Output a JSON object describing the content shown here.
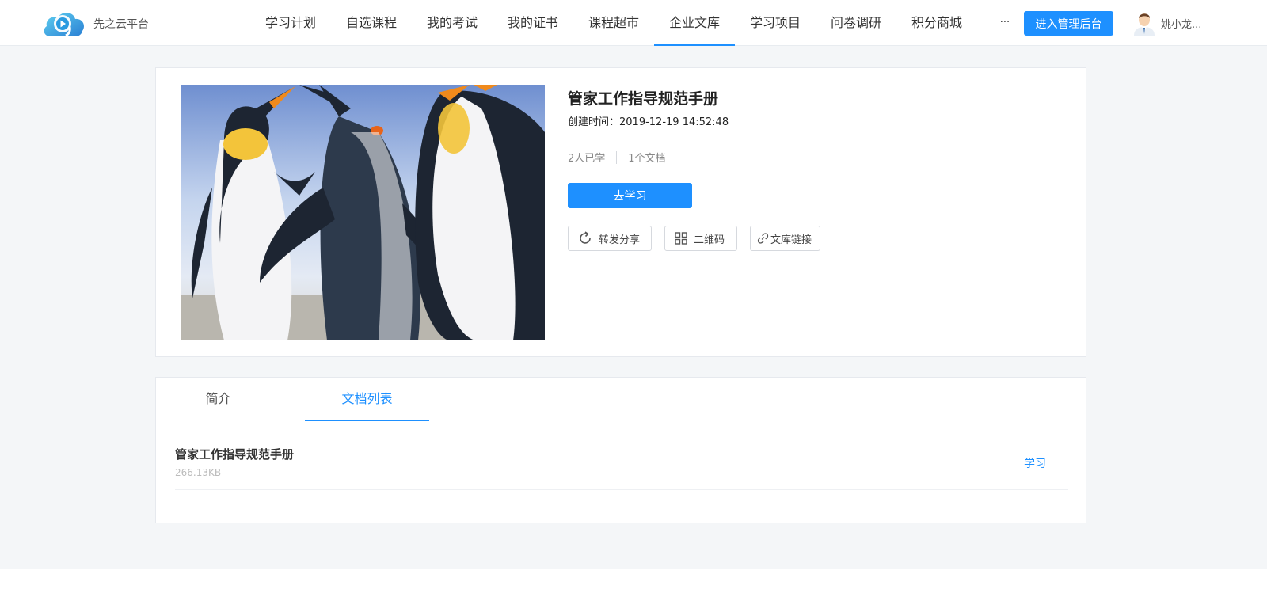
{
  "header": {
    "logo_text": "先之云平台",
    "nav": [
      {
        "label": "学习计划",
        "active": false
      },
      {
        "label": "自选课程",
        "active": false
      },
      {
        "label": "我的考试",
        "active": false
      },
      {
        "label": "我的证书",
        "active": false
      },
      {
        "label": "课程超市",
        "active": false
      },
      {
        "label": "企业文库",
        "active": true
      },
      {
        "label": "学习项目",
        "active": false
      },
      {
        "label": "问卷调研",
        "active": false
      },
      {
        "label": "积分商城",
        "active": false
      },
      {
        "label": "···",
        "active": false
      }
    ],
    "admin_button": "进入管理后台",
    "user_name": "姚小龙...",
    "accent_color": "#1e90ff"
  },
  "detail": {
    "title": "管家工作指导规范手册",
    "created_label": "创建时间：",
    "created_at": "2019-12-19 14:52:48",
    "learners": "2人已学",
    "doc_count": "1个文档",
    "study_button": "去学习",
    "actions": {
      "share": "转发分享",
      "qrcode": "二维码",
      "link": "文库链接"
    }
  },
  "tabs": [
    {
      "label": "简介",
      "active": false
    },
    {
      "label": "文档列表",
      "active": true
    }
  ],
  "documents": [
    {
      "name": "管家工作指导规范手册",
      "size": "266.13KB",
      "action": "学习"
    }
  ]
}
